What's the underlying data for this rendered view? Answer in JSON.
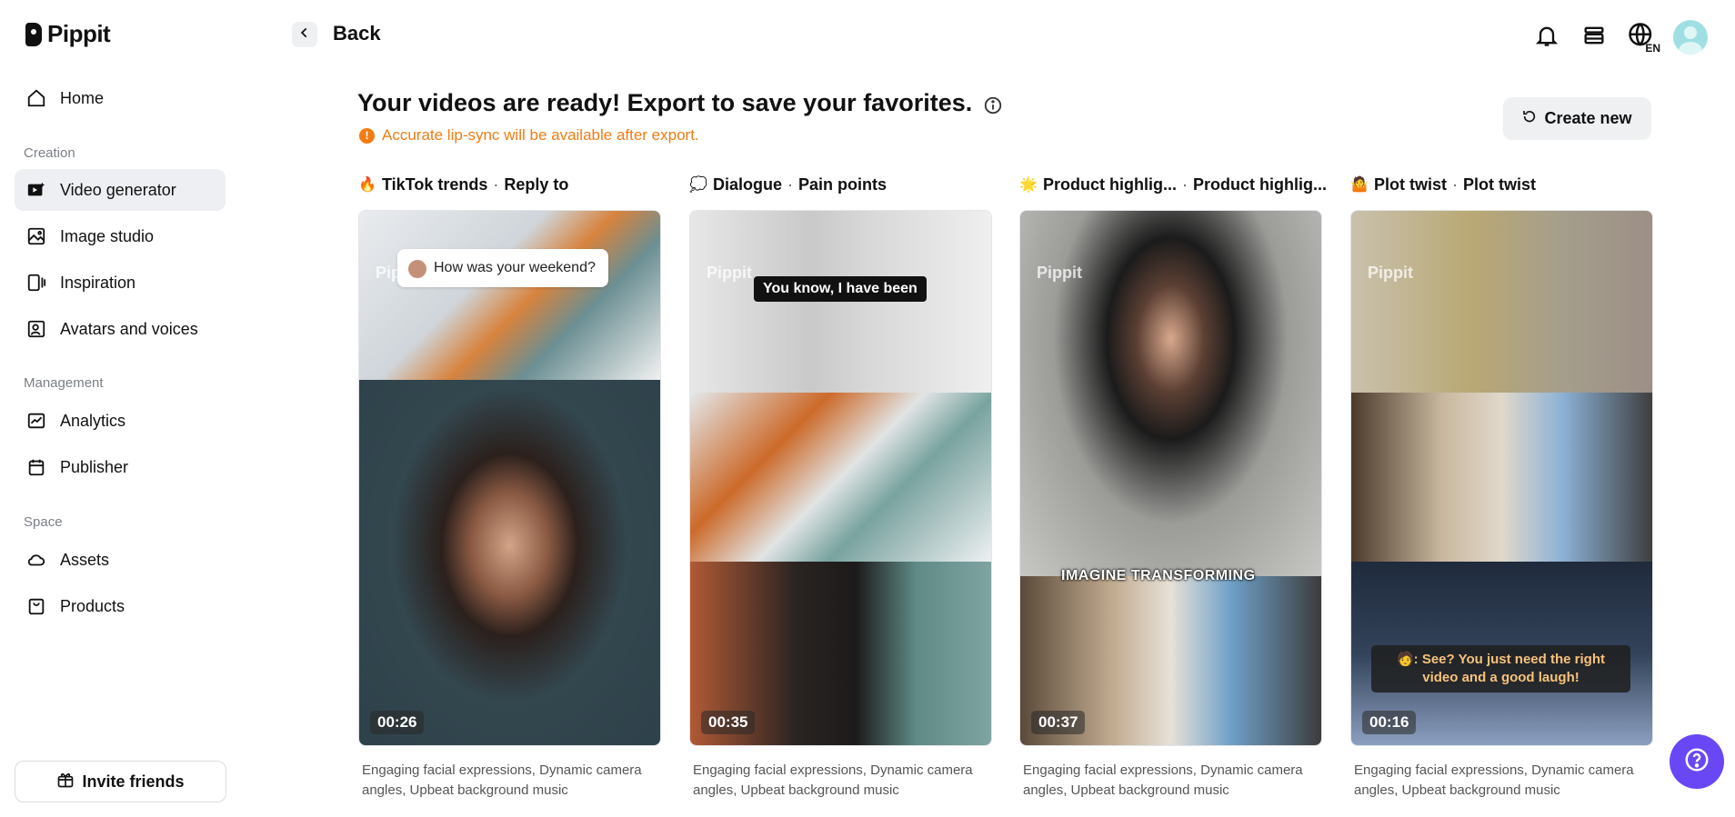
{
  "brand": {
    "name": "Pippit"
  },
  "sidebar": {
    "nav_top": [
      {
        "label": "Home",
        "icon": "home-icon"
      }
    ],
    "sections": [
      {
        "title": "Creation",
        "items": [
          {
            "label": "Video generator",
            "icon": "video-generator-icon",
            "active": true
          },
          {
            "label": "Image studio",
            "icon": "image-studio-icon"
          },
          {
            "label": "Inspiration",
            "icon": "inspiration-icon"
          },
          {
            "label": "Avatars and voices",
            "icon": "avatar-voice-icon"
          }
        ]
      },
      {
        "title": "Management",
        "items": [
          {
            "label": "Analytics",
            "icon": "analytics-icon"
          },
          {
            "label": "Publisher",
            "icon": "calendar-icon"
          }
        ]
      },
      {
        "title": "Space",
        "items": [
          {
            "label": "Assets",
            "icon": "cloud-icon"
          },
          {
            "label": "Products",
            "icon": "product-icon"
          }
        ]
      }
    ],
    "invite_label": "Invite friends"
  },
  "header": {
    "back_label": "Back",
    "language": "EN"
  },
  "main": {
    "title": "Your videos are ready! Export to save your favorites.",
    "notice": "Accurate lip-sync will be available after export.",
    "create_new_label": "Create new",
    "cards": [
      {
        "emoji": "🔥",
        "title_a": "TikTok trends",
        "title_b": "Reply to",
        "duration": "00:26",
        "overlay_text": "How was your weekend?",
        "watermark": "Pippit",
        "description": "Engaging facial expressions, Dynamic camera angles, Upbeat background music"
      },
      {
        "emoji": "💭",
        "title_a": "Dialogue",
        "title_b": "Pain points",
        "duration": "00:35",
        "overlay_text": "You know, I have been",
        "watermark": "Pippit",
        "description": "Engaging facial expressions, Dynamic camera angles, Upbeat background music"
      },
      {
        "emoji": "🌟",
        "title_a": "Product highlig...",
        "title_b": "Product highlig...",
        "duration": "00:37",
        "overlay_text": "IMAGINE TRANSFORMING",
        "watermark": "Pippit",
        "description": "Engaging facial expressions, Dynamic camera angles, Upbeat background music"
      },
      {
        "emoji": "🤷",
        "title_a": "Plot twist",
        "title_b": "Plot twist",
        "duration": "00:16",
        "overlay_text": "🧑: See? You just need the right video and a good laugh!",
        "watermark": "Pippit",
        "description": "Engaging facial expressions, Dynamic camera angles, Upbeat background music"
      }
    ]
  }
}
